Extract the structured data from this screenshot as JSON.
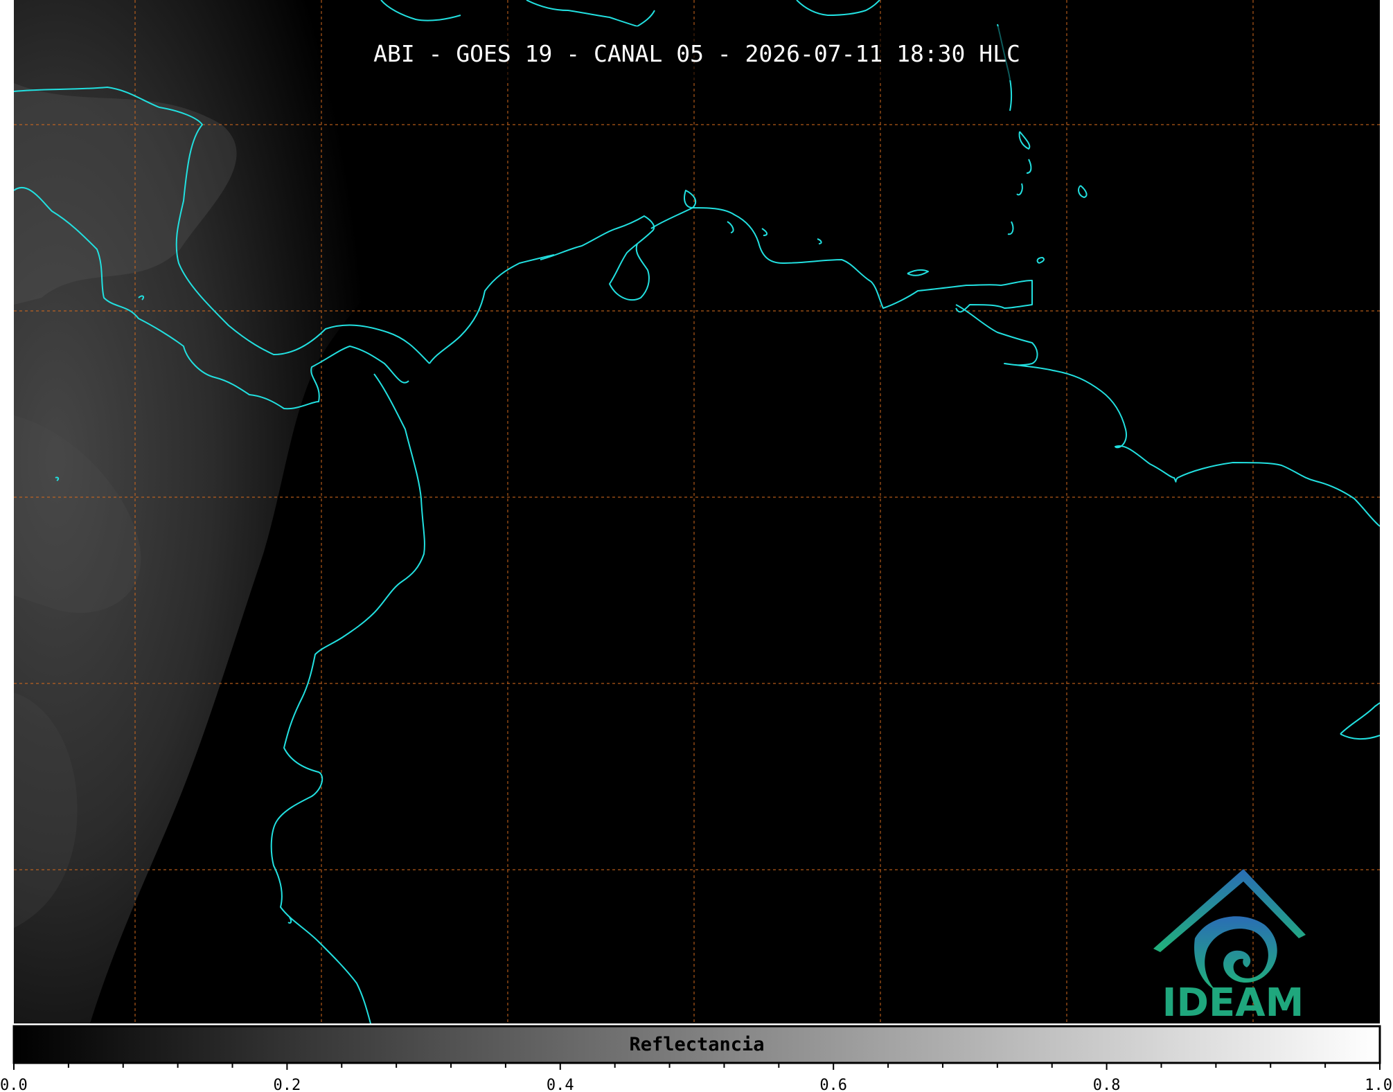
{
  "title": "ABI - GOES 19 - CANAL 05 - 2026-07-11 18:30 HLC",
  "colorbar": {
    "label": "Reflectancia",
    "range": [
      0.0,
      1.0
    ],
    "tick_labels": [
      "0.0",
      "0.2",
      "0.4",
      "0.6",
      "0.8",
      "1.0"
    ],
    "minor_ticks_per_major": 4,
    "colors": {
      "low": "#000000",
      "high": "#ffffff"
    }
  },
  "map": {
    "background": "#000000",
    "coastline_color": "#22e0e0",
    "gridline_color": "#d2691e",
    "gridline_style": "dashed",
    "cloud_region": "west-side"
  },
  "logo": {
    "text": "IDEAM",
    "icon": "ideam-mountain-spiral-icon",
    "colors": {
      "top": "#2a6db5",
      "bottom": "#21b27a"
    }
  }
}
